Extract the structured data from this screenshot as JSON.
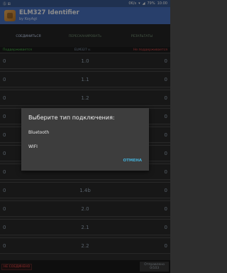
{
  "statusbar": {
    "left": "Ⓢ ⊞",
    "speed": "0K/s",
    "battery": "79%",
    "time": "10:00"
  },
  "app": {
    "title": "ELM327 Identifier",
    "subtitle": "by KoyAgt"
  },
  "tabs": [
    {
      "label": "СОЕДИНИТЬСЯ"
    },
    {
      "label": "ПЕРЕСКАНИРОВАТЬ"
    },
    {
      "label": "РЕЗУЛЬТАТЫ"
    }
  ],
  "header": {
    "supported": "Поддерживается",
    "center": "ELM327 v.",
    "unsupported": "Не поддерживается"
  },
  "rows": [
    {
      "left": "0",
      "version": "1.0",
      "right": "0"
    },
    {
      "left": "0",
      "version": "1.1",
      "right": "0"
    },
    {
      "left": "0",
      "version": "1.2",
      "right": "0"
    },
    {
      "left": "0",
      "version": "",
      "right": "0"
    },
    {
      "left": "0",
      "version": "",
      "right": "0"
    },
    {
      "left": "0",
      "version": "",
      "right": "0"
    },
    {
      "left": "0",
      "version": "",
      "right": "0"
    },
    {
      "left": "0",
      "version": "1.4b",
      "right": "0"
    },
    {
      "left": "0",
      "version": "2.0",
      "right": "0"
    },
    {
      "left": "0",
      "version": "2.1",
      "right": "0"
    },
    {
      "left": "0",
      "version": "2.2",
      "right": "0"
    }
  ],
  "bottombar": {
    "status": "НЕ СОЕДИНЕНО",
    "sent_label": "Отправлено",
    "sent_value": "0/103"
  },
  "dialog": {
    "title": "Выберите тип подключения:",
    "options": [
      "Bluetooth",
      "WIFI"
    ],
    "cancel": "ОТМЕНА"
  },
  "colors": {
    "appbar": "#4a74c4",
    "supported": "#4cc24c",
    "unsupported": "#e04a4a",
    "accent": "#44b0d8"
  }
}
